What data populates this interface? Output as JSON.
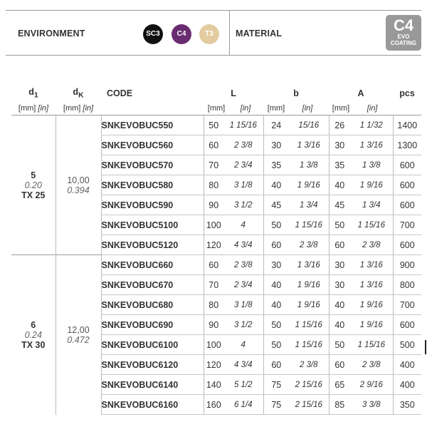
{
  "top": {
    "environment_label": "ENVIRONMENT",
    "material_label": "MATERIAL",
    "badges": [
      {
        "text": "SC3",
        "color": "#111111"
      },
      {
        "text": "C4",
        "color": "#6a2c70"
      },
      {
        "text": "T3",
        "color": "#e2cc9f"
      }
    ],
    "coating": {
      "big": "C4",
      "line1": "EVO",
      "line2": "COATING"
    }
  },
  "header": {
    "d1": "d",
    "d1_sub": "1",
    "dk": "d",
    "dk_sub": "K",
    "code": "CODE",
    "L": "L",
    "b": "b",
    "A": "A",
    "pcs": "pcs",
    "mm": "[mm]",
    "in": "[in]"
  },
  "groups": [
    {
      "d1": "5",
      "d1_in": "0.20",
      "tx": "TX 25",
      "dk": "10,00",
      "dk_in": "0.394",
      "rows": [
        {
          "code": "SNKEVOBUC550",
          "L_mm": "50",
          "L_in": "1 15/16",
          "b_mm": "24",
          "b_in": "15/16",
          "A_mm": "26",
          "A_in": "1 1/32",
          "pcs": "1400"
        },
        {
          "code": "SNKEVOBUC560",
          "L_mm": "60",
          "L_in": "2 3/8",
          "b_mm": "30",
          "b_in": "1 3/16",
          "A_mm": "30",
          "A_in": "1 3/16",
          "pcs": "1300"
        },
        {
          "code": "SNKEVOBUC570",
          "L_mm": "70",
          "L_in": "2 3/4",
          "b_mm": "35",
          "b_in": "1 3/8",
          "A_mm": "35",
          "A_in": "1 3/8",
          "pcs": "600"
        },
        {
          "code": "SNKEVOBUC580",
          "L_mm": "80",
          "L_in": "3 1/8",
          "b_mm": "40",
          "b_in": "1 9/16",
          "A_mm": "40",
          "A_in": "1 9/16",
          "pcs": "600"
        },
        {
          "code": "SNKEVOBUC590",
          "L_mm": "90",
          "L_in": "3 1/2",
          "b_mm": "45",
          "b_in": "1 3/4",
          "A_mm": "45",
          "A_in": "1 3/4",
          "pcs": "600"
        },
        {
          "code": "SNKEVOBUC5100",
          "L_mm": "100",
          "L_in": "4",
          "b_mm": "50",
          "b_in": "1 15/16",
          "A_mm": "50",
          "A_in": "1 15/16",
          "pcs": "700"
        },
        {
          "code": "SNKEVOBUC5120",
          "L_mm": "120",
          "L_in": "4 3/4",
          "b_mm": "60",
          "b_in": "2 3/8",
          "A_mm": "60",
          "A_in": "2 3/8",
          "pcs": "600"
        }
      ]
    },
    {
      "d1": "6",
      "d1_in": "0.24",
      "tx": "TX 30",
      "dk": "12,00",
      "dk_in": "0.472",
      "rows": [
        {
          "code": "SNKEVOBUC660",
          "L_mm": "60",
          "L_in": "2 3/8",
          "b_mm": "30",
          "b_in": "1 3/16",
          "A_mm": "30",
          "A_in": "1 3/16",
          "pcs": "900"
        },
        {
          "code": "SNKEVOBUC670",
          "L_mm": "70",
          "L_in": "2 3/4",
          "b_mm": "40",
          "b_in": "1 9/16",
          "A_mm": "30",
          "A_in": "1 3/16",
          "pcs": "800"
        },
        {
          "code": "SNKEVOBUC680",
          "L_mm": "80",
          "L_in": "3 1/8",
          "b_mm": "40",
          "b_in": "1 9/16",
          "A_mm": "40",
          "A_in": "1 9/16",
          "pcs": "700"
        },
        {
          "code": "SNKEVOBUC690",
          "L_mm": "90",
          "L_in": "3 1/2",
          "b_mm": "50",
          "b_in": "1 15/16",
          "A_mm": "40",
          "A_in": "1 9/16",
          "pcs": "600"
        },
        {
          "code": "SNKEVOBUC6100",
          "L_mm": "100",
          "L_in": "4",
          "b_mm": "50",
          "b_in": "1 15/16",
          "A_mm": "50",
          "A_in": "1 15/16",
          "pcs": "500"
        },
        {
          "code": "SNKEVOBUC6120",
          "L_mm": "120",
          "L_in": "4 3/4",
          "b_mm": "60",
          "b_in": "2 3/8",
          "A_mm": "60",
          "A_in": "2 3/8",
          "pcs": "400"
        },
        {
          "code": "SNKEVOBUC6140",
          "L_mm": "140",
          "L_in": "5 1/2",
          "b_mm": "75",
          "b_in": "2 15/16",
          "A_mm": "65",
          "A_in": "2 9/16",
          "pcs": "400"
        },
        {
          "code": "SNKEVOBUC6160",
          "L_mm": "160",
          "L_in": "6 1/4",
          "b_mm": "75",
          "b_in": "2 15/16",
          "A_mm": "85",
          "A_in": "3 3/8",
          "pcs": "350"
        }
      ]
    }
  ]
}
